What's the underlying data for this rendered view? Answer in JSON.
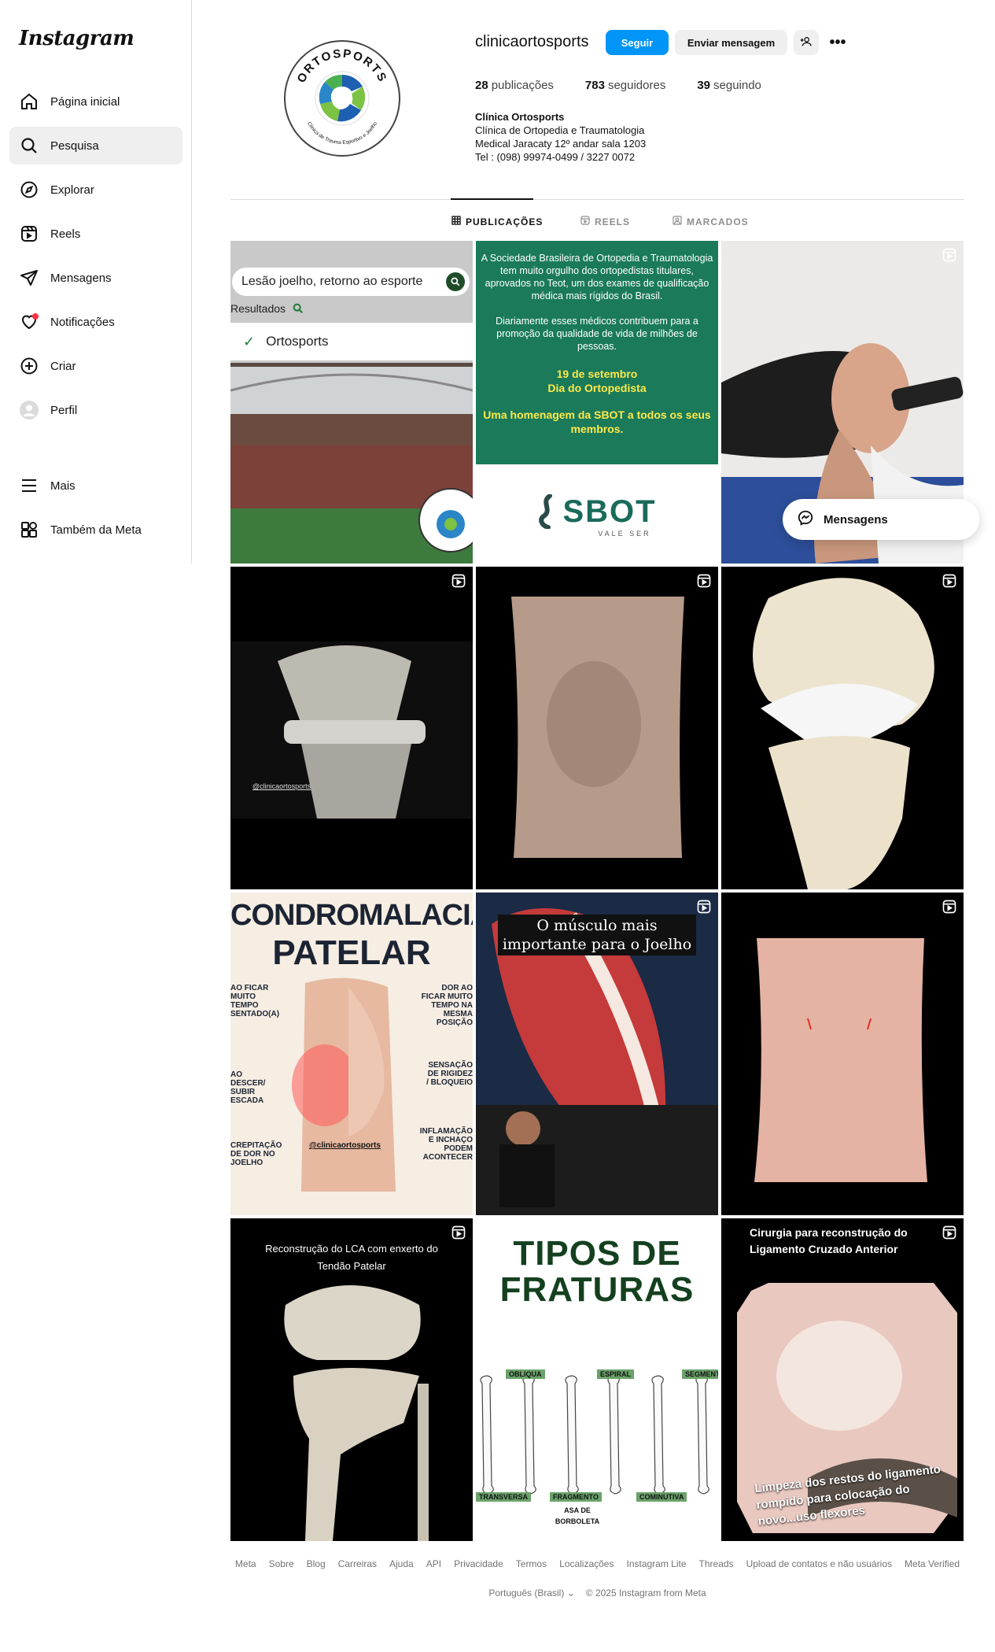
{
  "brand": {
    "logo": "Instagram"
  },
  "sidebar": {
    "items": [
      {
        "label": "Página inicial",
        "icon": "home-icon"
      },
      {
        "label": "Pesquisa",
        "icon": "search-icon"
      },
      {
        "label": "Explorar",
        "icon": "compass-icon"
      },
      {
        "label": "Reels",
        "icon": "reels-icon"
      },
      {
        "label": "Mensagens",
        "icon": "send-icon"
      },
      {
        "label": "Notificações",
        "icon": "heart-icon"
      },
      {
        "label": "Criar",
        "icon": "plus-square-icon"
      },
      {
        "label": "Perfil",
        "icon": "avatar-icon"
      },
      {
        "label": "Mais",
        "icon": "menu-icon"
      },
      {
        "label": "Também da Meta",
        "icon": "meta-apps-icon"
      }
    ]
  },
  "profile": {
    "username": "clinicaortosports",
    "follow_label": "Seguir",
    "message_label": "Enviar mensagem",
    "stats": {
      "posts_count": "28",
      "posts_label": "publicações",
      "followers_count": "783",
      "followers_label": "seguidores",
      "following_count": "39",
      "following_label": "seguindo"
    },
    "bio": {
      "name": "Clínica Ortosports",
      "line1": "Clínica de Ortopedia e Traumatologia",
      "line2": "Medical Jaracaty 12º andar sala 1203",
      "line3": "Tel : (098) 99974-0499 / 3227 0072"
    },
    "avatar_text": {
      "top": "ORTOSPORTS",
      "bottom": "Clínica de Trauma Esportivo e Joelho"
    }
  },
  "tabs": [
    {
      "label": "PUBLICAÇÕES",
      "active": true
    },
    {
      "label": "REELS",
      "active": false
    },
    {
      "label": "MARCADOS",
      "active": false
    }
  ],
  "posts": {
    "p1": {
      "search_text": "Lesão joelho, retorno ao esporte",
      "results_label": "Resultados",
      "check_label": "Ortosports"
    },
    "p2": {
      "para1": "A Sociedade Brasileira de Ortopedia e Traumatologia tem muito orgulho dos ortopedistas titulares, aprovados no Teot, um dos exames de qualificação médica mais rígidos do Brasil.",
      "para2": "Diariamente esses médicos contribuem para a promoção da qualidade de vida de milhões de pessoas.",
      "date": "19 de setembro",
      "day": "Dia do Ortopedista",
      "tribute": "Uma homenagem da SBOT a todos os seus membros.",
      "logo": "SBOT",
      "logo_sub": "VALE SER"
    },
    "p4": {
      "handle": "@clinicaortosports"
    },
    "p7": {
      "title1": "CONDROMALACIA",
      "title2": "PATELAR",
      "left1": "AO FICAR MUITO TEMPO SENTADO(A)",
      "right1": "DOR AO FICAR MUITO TEMPO NA MESMA POSIÇÃO",
      "left2": "AO DESCER/ SUBIR ESCADA",
      "right2": "SENSAÇÃO DE RIGIDEZ / BLOQUEIO",
      "left3": "CREPITAÇÃO DE DOR NO JOELHO",
      "right3": "INFLAMAÇÃO E INCHAÇO PODEM ACONTECER",
      "handle": "@clinicaortosports"
    },
    "p8": {
      "caption": "O músculo mais importante para o Joelho"
    },
    "p10": {
      "caption": "Reconstrução do LCA com enxerto do Tendão Patelar"
    },
    "p11": {
      "title1": "TIPOS DE",
      "title2": "FRATURAS",
      "l1": "OBLIQUA",
      "l2": "ESPIRAL",
      "l3": "SEGMENTAR",
      "l4": "TRANSVERSA",
      "l5": "FRAGMENTO",
      "l6": "COMINUTIVA",
      "l7": "ASA DE BORBOLETA"
    },
    "p12": {
      "title": "Cirurgia para reconstrução do Ligamento Cruzado Anterior",
      "caption": "Limpeza dos restos do ligamento rompido para colocação do novo...uso flexores"
    }
  },
  "floating": {
    "messages_label": "Mensagens"
  },
  "footer": {
    "links": [
      "Meta",
      "Sobre",
      "Blog",
      "Carreiras",
      "Ajuda",
      "API",
      "Privacidade",
      "Termos",
      "Localizações",
      "Instagram Lite",
      "Threads",
      "Upload de contatos e não usuários",
      "Meta Verified"
    ],
    "language": "Português (Brasil)",
    "copyright": "© 2025 Instagram from Meta"
  },
  "colors": {
    "accent": "#0095f6",
    "green_post": "#1a7a5a",
    "notification_dot": "#ff3040"
  }
}
